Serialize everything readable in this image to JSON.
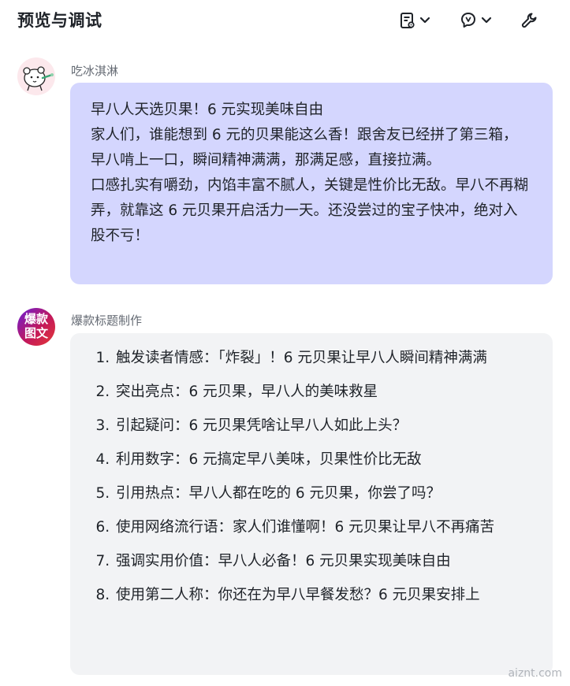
{
  "header": {
    "title": "预览与调试",
    "tools": [
      "document-settings-icon",
      "ai-assist-icon",
      "wrench-icon"
    ]
  },
  "messages": [
    {
      "sender": "吃冰淇淋",
      "avatar": "cartoon-bear-icon",
      "paragraphs": [
        "早八人天选贝果！6 元实现美味自由",
        "家人们，谁能想到 6 元的贝果能这么香！跟舍友已经拼了第三箱，早八啃上一口，瞬间精神满满，那满足感，直接拉满。",
        "口感扎实有嚼劲，内馅丰富不腻人，关键是性价比无敌。早八不再糊弄，就靠这 6 元贝果开启活力一天。还没尝过的宝子快冲，绝对入股不亏！"
      ]
    },
    {
      "sender": "爆款标题制作",
      "avatar_text": [
        "爆款",
        "图文"
      ],
      "items": [
        "触发读者情感：「炸裂」！6 元贝果让早八人瞬间精神满满",
        "突出亮点：6 元贝果，早八人的美味救星",
        "引起疑问：6 元贝果凭啥让早八人如此上头？",
        "利用数字：6 元搞定早八美味，贝果性价比无敌",
        "引用热点：早八人都在吃的 6 元贝果，你尝了吗？",
        "使用网络流行语：家人们谁懂啊！6 元贝果让早八不再痛苦",
        "强调实用价值：早八人必备！6 元贝果实现美味自由",
        "使用第二人称：你还在为早八早餐发愁？6 元贝果安排上"
      ]
    }
  ],
  "watermark": "aiznt.com",
  "colors": {
    "user_bubble": "#d4d6fe",
    "bot_bubble": "#f2f3f5",
    "text": "#1f2329",
    "muted": "#646a73"
  }
}
